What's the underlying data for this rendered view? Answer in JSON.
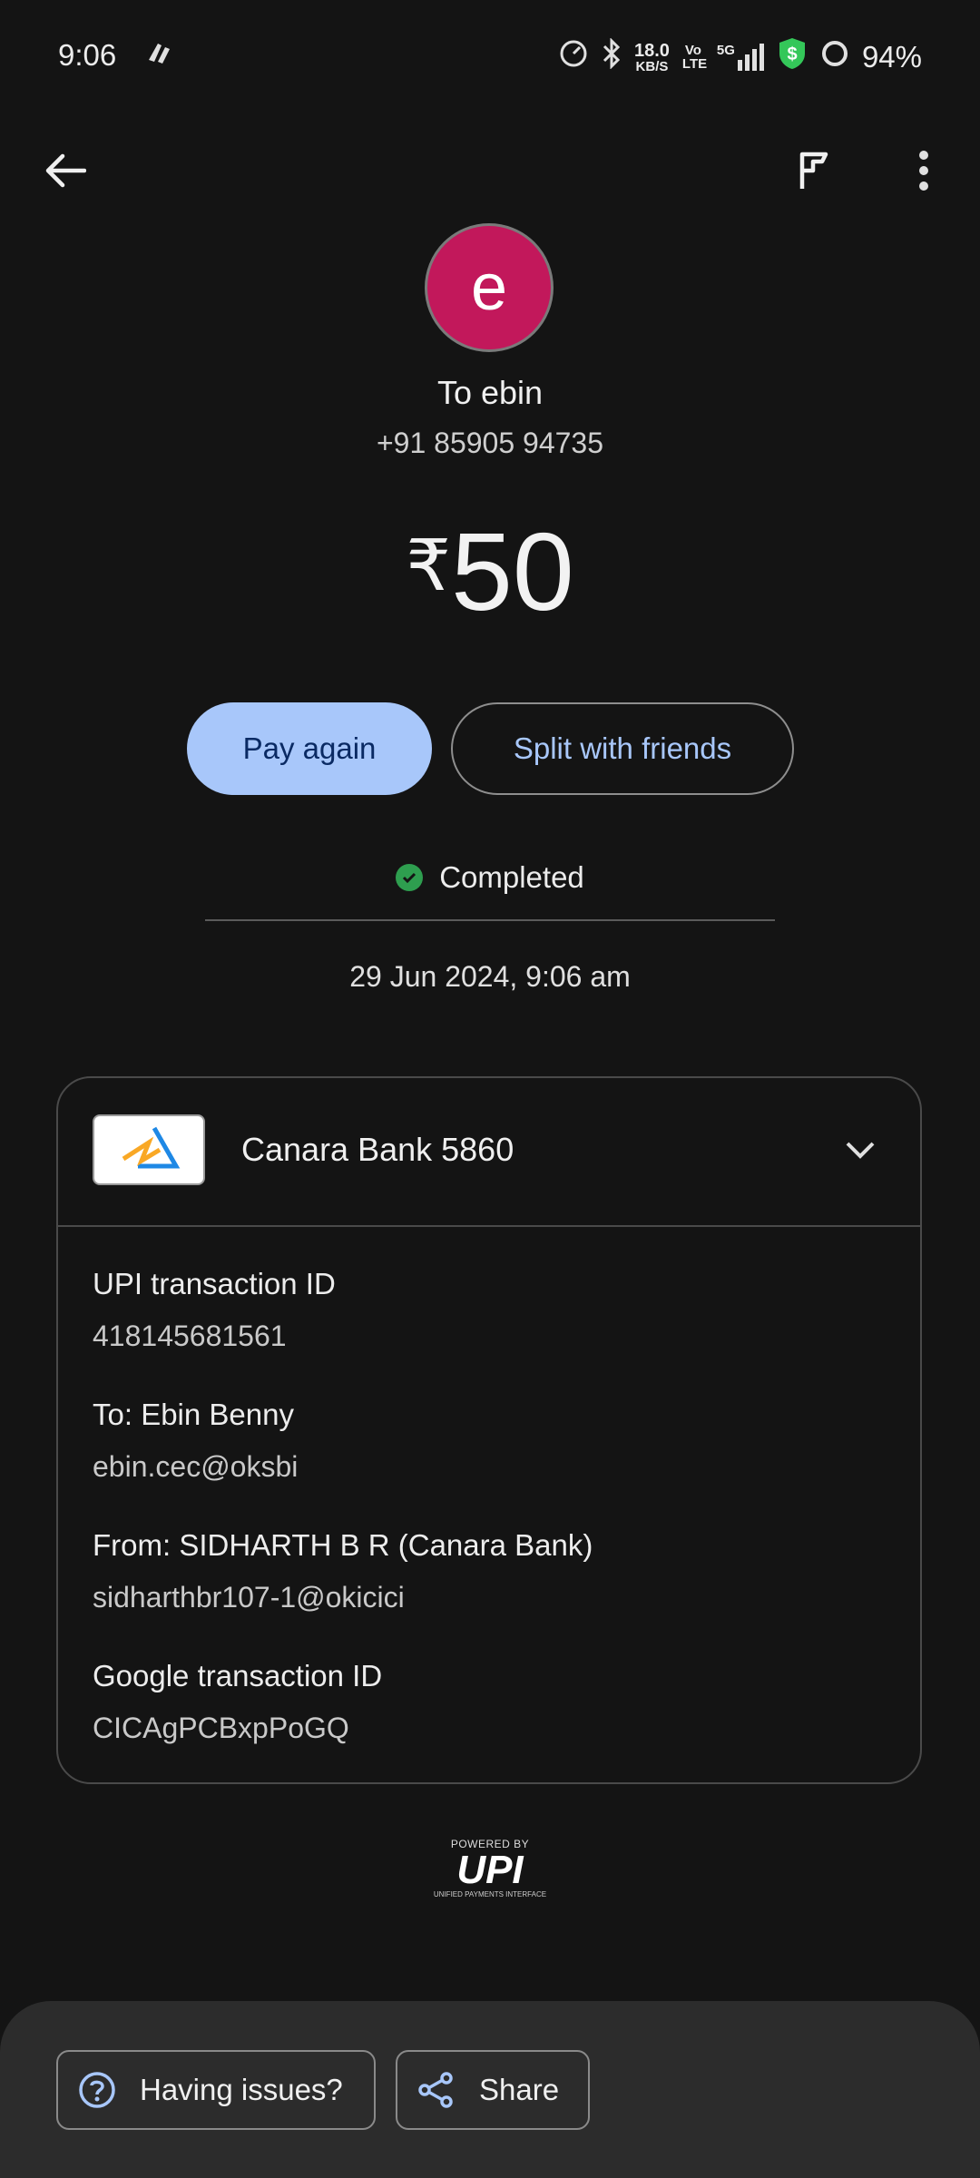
{
  "status_bar": {
    "time": "9:06",
    "net_speed": "18.0",
    "net_unit": "KB/S",
    "volte": "Vo LTE",
    "network": "5G",
    "battery": "94%"
  },
  "top_bar": {
    "icons": [
      "back-arrow-icon",
      "flag-icon",
      "more-vert-icon"
    ]
  },
  "payee": {
    "avatar_letter": "e",
    "avatar_color": "#c2185b",
    "title": "To ebin",
    "phone": "+91 85905 94735"
  },
  "amount": {
    "currency": "₹",
    "value": "50"
  },
  "actions": {
    "pay_again": "Pay again",
    "split": "Split with friends"
  },
  "status": {
    "label": "Completed",
    "color": "#2e9e4f"
  },
  "date": "29 Jun 2024, 9:06 am",
  "details": {
    "bank": "Canara Bank 5860",
    "fields": [
      {
        "label": "UPI transaction ID",
        "value": "418145681561"
      },
      {
        "label": "To: Ebin  Benny",
        "value": "ebin.cec@oksbi"
      },
      {
        "label": "From: SIDHARTH B R (Canara Bank)",
        "value": "sidharthbr107-1@okicici"
      },
      {
        "label": "Google transaction ID",
        "value": "CICAgPCBxpPoGQ"
      }
    ]
  },
  "upi": {
    "powered_by": "POWERED BY",
    "logo": "UPI",
    "sub": "UNIFIED PAYMENTS INTERFACE"
  },
  "bottom": {
    "issues": "Having issues?",
    "share": "Share"
  }
}
